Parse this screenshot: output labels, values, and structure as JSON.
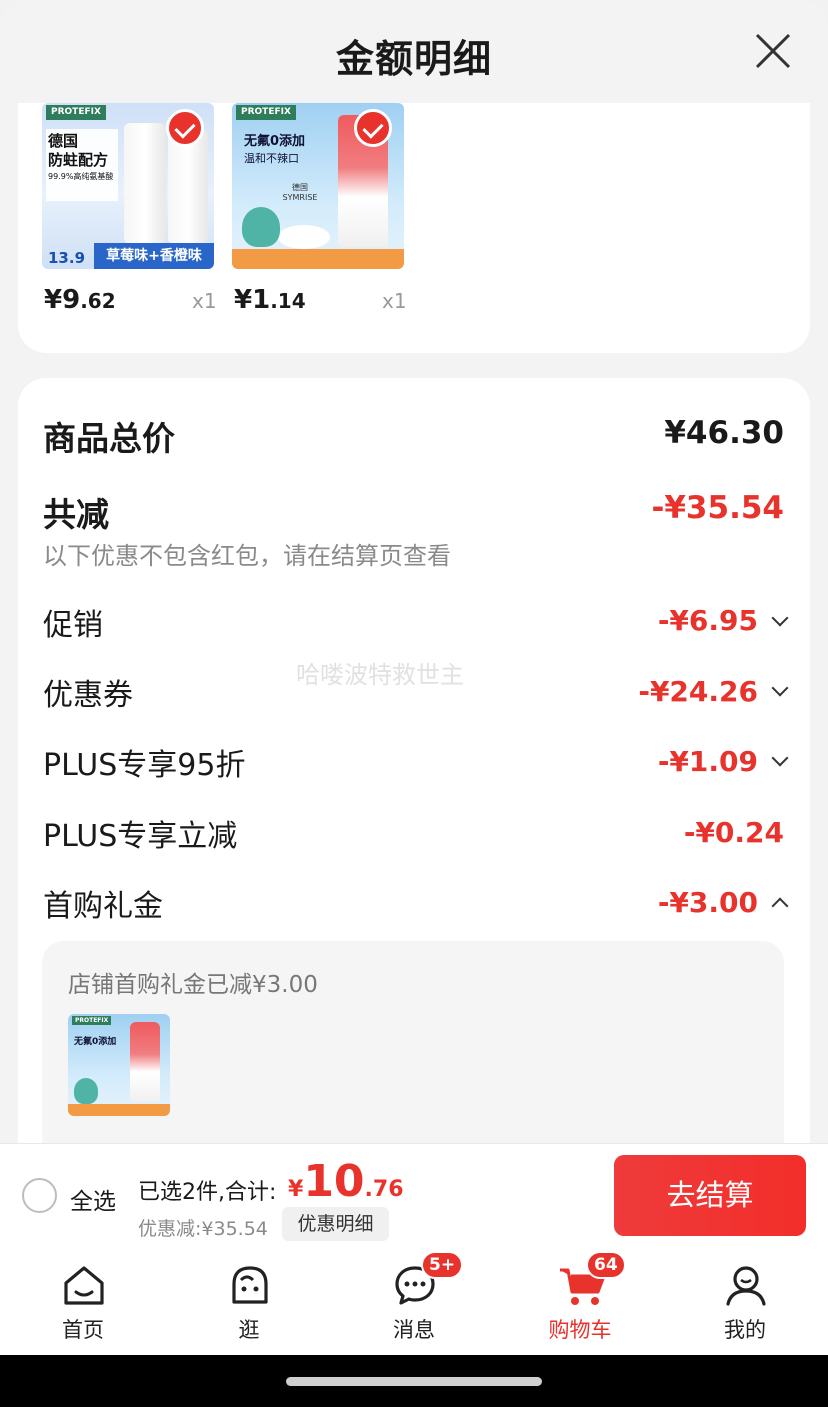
{
  "sheet": {
    "title": "金额明细",
    "close_icon": "close-icon"
  },
  "products": [
    {
      "brand": "PROTEFIX",
      "promo_lines": [
        "德国",
        "防蛀配方",
        "99.9%高纯氨基酸"
      ],
      "small_price": "13.9",
      "flavor": "草莓味+香橙味",
      "price_int": "¥9",
      "price_dec": ".62",
      "qty": "x1",
      "selected": true
    },
    {
      "brand": "PROTEFIX",
      "promo_lines": [
        "无氟0添加",
        "温和不辣口",
        "德国 SYMRISE"
      ],
      "price_int": "¥1",
      "price_dec": ".14",
      "qty": "x1",
      "selected": true
    }
  ],
  "summary": {
    "total_label": "商品总价",
    "total_value": "¥46.30",
    "reduce_label": "共减",
    "reduce_value": "-¥35.54",
    "note": "以下优惠不包含红包，请在结算页查看",
    "watermark": "哈喽波特救世主",
    "rows": [
      {
        "label": "促销",
        "value": "-¥6.95",
        "chevron": "down"
      },
      {
        "label": "优惠券",
        "value": "-¥24.26",
        "chevron": "down"
      },
      {
        "label": "PLUS专享95折",
        "value": "-¥1.09",
        "chevron": "down"
      },
      {
        "label": "PLUS专享立减",
        "value": "-¥0.24",
        "chevron": ""
      },
      {
        "label": "首购礼金",
        "value": "-¥3.00",
        "chevron": "up"
      }
    ],
    "gift_text": "店铺首购礼金已减¥3.00"
  },
  "bottom_bar": {
    "select_all": "全选",
    "selected_count": "已选2件,合计:",
    "total_currency": "¥",
    "total_int": "10",
    "total_dec": ".76",
    "discount": "优惠减:¥35.54",
    "detail_button": "优惠明细",
    "checkout_button": "去结算"
  },
  "tabs": [
    {
      "label": "首页",
      "icon": "home-icon",
      "active": false
    },
    {
      "label": "逛",
      "icon": "browse-icon",
      "active": false
    },
    {
      "label": "消息",
      "icon": "message-icon",
      "badge": "5+",
      "active": false
    },
    {
      "label": "购物车",
      "icon": "cart-icon",
      "badge": "64",
      "active": true
    },
    {
      "label": "我的",
      "icon": "profile-icon",
      "active": false
    }
  ],
  "colors": {
    "accent": "#e8322c",
    "background": "#f3f3f3"
  }
}
